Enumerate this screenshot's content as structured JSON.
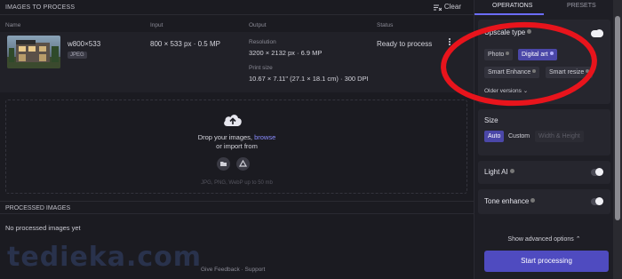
{
  "left_header": {
    "title": "IMAGES TO PROCESS",
    "clear_label": "Clear"
  },
  "columns": {
    "input": "Input",
    "output": "Output",
    "status": "Status"
  },
  "image_row": {
    "filename": "w800×533",
    "format_badge": "JPEG",
    "input_info": "800 × 533 px · 0.5 MP",
    "output_resolution_label": "Resolution",
    "output_resolution": "3200 × 2132 px · 6.9 MP",
    "output_print_label": "Print size",
    "output_print": "10.67 × 7.11\" (27.1 × 18.1 cm) · 300 DPI",
    "status": "Ready to process"
  },
  "dropzone": {
    "line1": "Drop your images,",
    "browse_link": "browse",
    "line2": "or import from",
    "hint": "JPG, PNG, WebP up to 50 mb"
  },
  "processed": {
    "title": "PROCESSED IMAGES",
    "empty_text": "No processed images yet"
  },
  "footer": {
    "feedback": "Give Feedback",
    "separator": "·",
    "support": "Support"
  },
  "watermark": "tedieka.com",
  "right_tabs": {
    "operations": "OPERATIONS",
    "presets": "PRESETS"
  },
  "upscale": {
    "title": "Upscale type",
    "options": [
      "Photo",
      "Digital art",
      "Smart Enhance",
      "Smart resize"
    ],
    "selected": "Digital art",
    "older_versions": "Older versions"
  },
  "size": {
    "title": "Size",
    "options": [
      "Auto",
      "Custom",
      "Width & Height"
    ],
    "selected": "Auto"
  },
  "light_ai": {
    "title": "Light AI"
  },
  "tone_enhance": {
    "title": "Tone enhance"
  },
  "advanced": {
    "label": "Show advanced options"
  },
  "start_button": "Start processing",
  "colors": {
    "accent": "#4f4bc0",
    "annotation": "#e8141c",
    "link": "#8a8cff"
  }
}
